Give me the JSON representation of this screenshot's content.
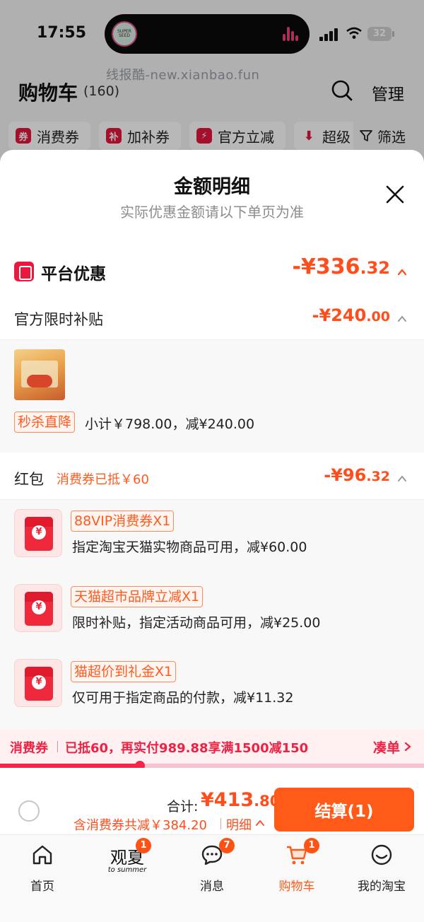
{
  "status_bar": {
    "time": "17:55",
    "island_app": "SUPER SEED",
    "battery": "32"
  },
  "watermark": "线报酷-new.xianbao.fun",
  "header": {
    "title": "购物车",
    "count": "(160)",
    "manage": "管理"
  },
  "filters": {
    "chips": [
      {
        "icon": "券",
        "label": "消费券"
      },
      {
        "icon": "补",
        "label": "加补券"
      },
      {
        "icon": "⚡",
        "label": "官方立减"
      },
      {
        "icon": "⬇",
        "label": "超级"
      }
    ],
    "filter_label": "筛选"
  },
  "sheet": {
    "title": "金额明细",
    "subtitle": "实际优惠金额请以下单页为准",
    "platform": {
      "label": "平台优惠",
      "amount_int": "-¥336",
      "amount_dec": ".32"
    },
    "subsidy": {
      "label": "官方限时补贴",
      "amount_int": "-¥240",
      "amount_dec": ".00",
      "product": {
        "tag": "秒杀直降",
        "detail": "小计￥798.00，减¥240.00"
      }
    },
    "redpack": {
      "label": "红包",
      "note": "消费券已抵￥60",
      "amount_int": "-¥96",
      "amount_dec": ".32",
      "coupons": [
        {
          "name": "88VIP消费券X1",
          "desc": "指定淘宝天猫实物商品可用，减¥60.00"
        },
        {
          "name": "天猫超市品牌立减X1",
          "desc": "限时补贴，指定活动商品可用，减¥25.00"
        },
        {
          "name": "猫超价到礼金X1",
          "desc": "仅可用于指定商品的付款，减¥11.32"
        }
      ]
    }
  },
  "promo": {
    "label": "消费券",
    "text": "已抵60，再实付989.88享满1500减150",
    "link": "凑单",
    "progress": 0.33
  },
  "checkout": {
    "total_label": "合计:",
    "total_int": "¥413",
    "total_dec": ".80",
    "detail_text": "含消费券共减￥384.20",
    "detail_link": "明细",
    "button": "结算(1)"
  },
  "tabbar": {
    "tabs": [
      {
        "label": "首页",
        "badge": ""
      },
      {
        "label": "观夏",
        "sub": "to summer",
        "badge": "1"
      },
      {
        "label": "消息",
        "badge": "7"
      },
      {
        "label": "购物车",
        "badge": "1"
      },
      {
        "label": "我的淘宝",
        "badge": ""
      }
    ]
  },
  "colors": {
    "accent": "#ff5a17",
    "price": "#ff4d1c",
    "brand_red": "#e8183f",
    "promo_red": "#ee2244"
  }
}
